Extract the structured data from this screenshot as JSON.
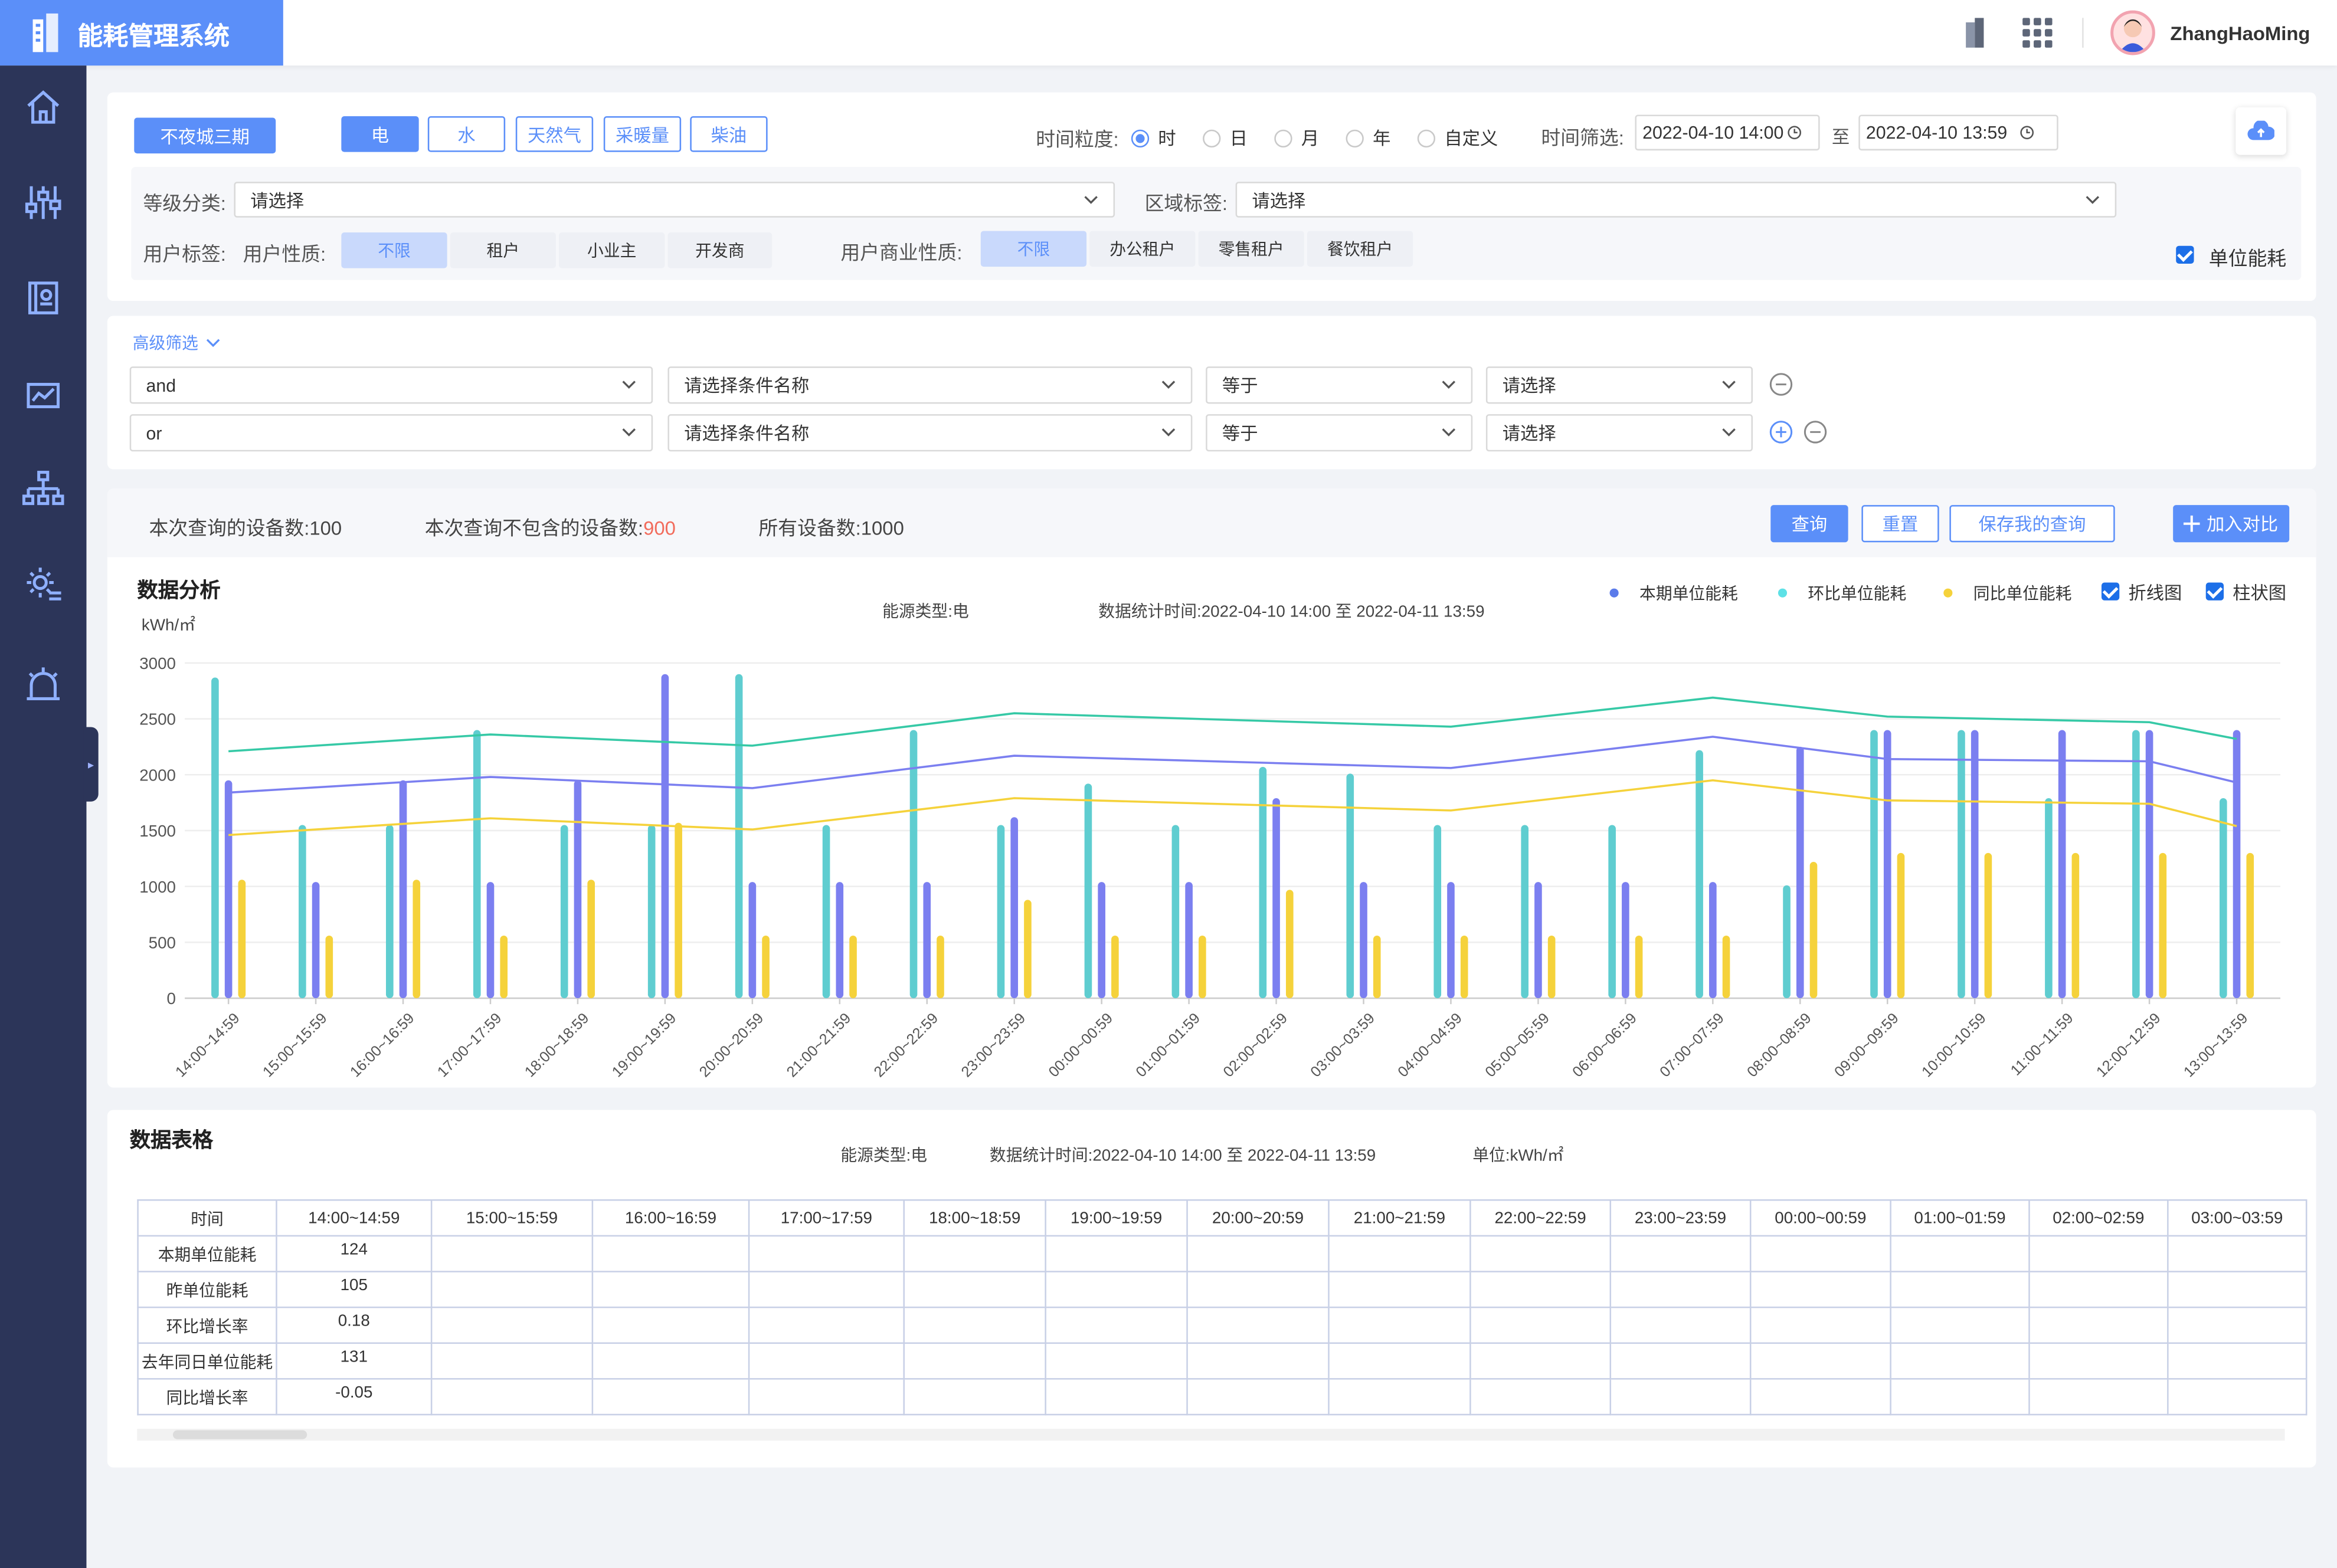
{
  "app": {
    "title": "能耗管理系统",
    "username": "ZhangHaoMing"
  },
  "filters": {
    "project": "不夜城三期",
    "energy_types": [
      "电",
      "水",
      "天然气",
      "采暖量",
      "柴油"
    ],
    "time_granularity_label": "时间粒度:",
    "granularity_options": [
      "时",
      "日",
      "月",
      "年",
      "自定义"
    ],
    "granularity_selected": "时",
    "time_filter_label": "时间筛选:",
    "time_start": "2022-04-10  14:00",
    "time_to": "至",
    "time_end": "2022-04-10   13:59",
    "level_label": "等级分类:",
    "level_placeholder": "请选择",
    "region_label": "区域标签:",
    "region_placeholder": "请选择",
    "user_tag_label": "用户标签:",
    "user_nature_label": "用户性质:",
    "user_nature_options": [
      "不限",
      "租户",
      "小业主",
      "开发商"
    ],
    "business_nature_label": "用户商业性质:",
    "business_nature_options": [
      "不限",
      "办公租户",
      "零售租户",
      "餐饮租户"
    ],
    "unit_energy_label": "单位能耗"
  },
  "advanced": {
    "toggle_label": "高级筛选",
    "rows": [
      {
        "logic": "and",
        "field": "请选择条件名称",
        "op": "等于",
        "value": "请选择"
      },
      {
        "logic": "or",
        "field": "请选择条件名称",
        "op": "等于",
        "value": "请选择"
      }
    ]
  },
  "stats": {
    "query_count_label": "本次查询的设备数:",
    "query_count": "100",
    "excluded_label": "本次查询不包含的设备数:",
    "excluded": "900",
    "total_label": "所有设备数:",
    "total": "1000",
    "query_btn": "查询",
    "reset_btn": "重置",
    "save_btn": "保存我的查询",
    "compare_btn": "加入对比"
  },
  "analysis": {
    "title": "数据分析",
    "unit": "kWh/㎡",
    "energy_type_label": "能源类型:",
    "energy_type": "电",
    "stat_time_label": "数据统计时间:",
    "stat_time": "2022-04-10  14:00  至  2022-04-11  13:59",
    "legend": [
      "本期单位能耗",
      "环比单位能耗",
      "同比单位能耗"
    ],
    "line_label": "折线图",
    "bar_label": "柱状图",
    "colors": {
      "current": "#7b7ff0",
      "mom": "#5fcdd0",
      "yoy": "#f5d23b",
      "line_current": "#7b7ff0",
      "line_mom": "#36c9a6",
      "line_yoy": "#f5d23b"
    }
  },
  "chart_data": {
    "type": "bar",
    "categories": [
      "14:00~14:59",
      "15:00~15:59",
      "16:00~16:59",
      "17:00~17:59",
      "18:00~18:59",
      "19:00~19:59",
      "20:00~20:59",
      "21:00~21:59",
      "22:00~22:59",
      "23:00~23:59",
      "00:00~00:59",
      "01:00~01:59",
      "02:00~02:59",
      "03:00~03:59",
      "04:00~04:59",
      "05:00~05:59",
      "06:00~06:59",
      "07:00~07:59",
      "08:00~08:59",
      "09:00~09:59",
      "10:00~10:59",
      "11:00~11:59",
      "12:00~12:59",
      "13:00~13:59"
    ],
    "ylim": [
      0,
      3000
    ],
    "yticks": [
      0,
      500,
      1000,
      1500,
      2000,
      2500,
      3000
    ],
    "series": [
      {
        "name": "环比单位能耗",
        "kind": "bar",
        "values": [
          2870,
          1550,
          1550,
          2400,
          1550,
          1550,
          2900,
          1550,
          2400,
          1550,
          1920,
          1550,
          2070,
          2010,
          1550,
          1550,
          1550,
          2220,
          1010,
          2400,
          2400,
          1790,
          2400,
          1790
        ]
      },
      {
        "name": "本期单位能耗",
        "kind": "bar",
        "values": [
          1950,
          1040,
          1950,
          1040,
          1950,
          2900,
          1040,
          1040,
          1040,
          1620,
          1040,
          1040,
          1790,
          1040,
          1040,
          1040,
          1040,
          1040,
          2250,
          2400,
          2400,
          2400,
          2400,
          2400
        ]
      },
      {
        "name": "同比单位能耗",
        "kind": "bar",
        "values": [
          1060,
          560,
          1060,
          560,
          1060,
          1570,
          560,
          560,
          560,
          880,
          560,
          560,
          970,
          560,
          560,
          560,
          560,
          560,
          1220,
          1300,
          1300,
          1300,
          1300,
          1300
        ]
      },
      {
        "name": "环比单位能耗",
        "kind": "line",
        "x": [
          "14:00~14:59",
          "17:00~17:59",
          "20:00~20:59",
          "23:00~23:59",
          "04:00~04:59",
          "07:00~07:59",
          "09:00~09:59",
          "12:00~12:59",
          "13:00~13:59"
        ],
        "values": [
          2210,
          2360,
          2260,
          2550,
          2430,
          2690,
          2520,
          2470,
          2320
        ]
      },
      {
        "name": "本期单位能耗",
        "kind": "line",
        "x": [
          "14:00~14:59",
          "17:00~17:59",
          "20:00~20:59",
          "23:00~23:59",
          "04:00~04:59",
          "07:00~07:59",
          "09:00~09:59",
          "12:00~12:59",
          "13:00~13:59"
        ],
        "values": [
          1840,
          1980,
          1880,
          2170,
          2060,
          2340,
          2140,
          2120,
          1930
        ]
      },
      {
        "name": "同比单位能耗",
        "kind": "line",
        "x": [
          "14:00~14:59",
          "17:00~17:59",
          "20:00~20:59",
          "23:00~23:59",
          "04:00~04:59",
          "07:00~07:59",
          "09:00~09:59",
          "12:00~12:59",
          "13:00~13:59"
        ],
        "values": [
          1460,
          1610,
          1510,
          1790,
          1680,
          1950,
          1770,
          1740,
          1540
        ]
      }
    ]
  },
  "table": {
    "title": "数据表格",
    "energy_type_label": "能源类型:",
    "energy_type": "电",
    "stat_time_label": "数据统计时间:",
    "stat_time": "2022-04-10  14:00  至  2022-04-11  13:59",
    "unit_label": "单位:",
    "unit": "kWh/㎡",
    "headers": [
      "时间",
      "14:00~14:59",
      "15:00~15:59",
      "16:00~16:59",
      "17:00~17:59",
      "18:00~18:59",
      "19:00~19:59",
      "20:00~20:59",
      "21:00~21:59",
      "22:00~22:59",
      "23:00~23:59",
      "00:00~00:59",
      "01:00~01:59",
      "02:00~02:59",
      "03:00~03:59"
    ],
    "rows": [
      {
        "label": "本期单位能耗",
        "value": "124"
      },
      {
        "label": "昨单位能耗",
        "value": "105"
      },
      {
        "label": "环比增长率",
        "value": "0.18"
      },
      {
        "label": "去年同日单位能耗",
        "value": "131"
      },
      {
        "label": "同比增长率",
        "value": "-0.05"
      }
    ]
  }
}
